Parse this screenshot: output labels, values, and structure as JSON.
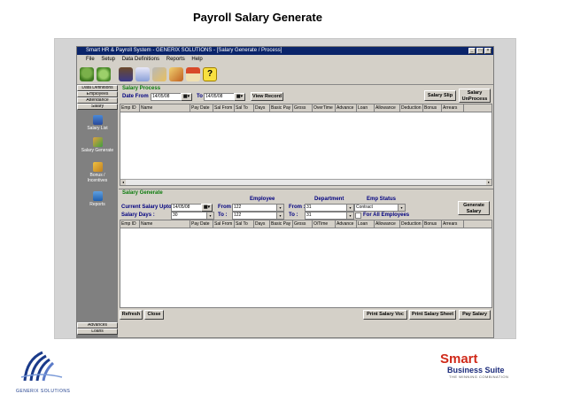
{
  "slide_title": "Payroll  Salary Generate",
  "window": {
    "title": "Smart HR & Payroll System - GENERIX SOLUTIONS - [Salary Generate / Process]",
    "menu": [
      "File",
      "Setup",
      "Data Definitions",
      "Reports",
      "Help"
    ]
  },
  "toolbar_icons": [
    "users-icon",
    "report-icon",
    "tools-icon",
    "edit-icon",
    "home-icon",
    "help-icon"
  ],
  "sidebar": {
    "tabs_top": [
      "Data Definitions",
      "Employees",
      "Attendance",
      "Salary"
    ],
    "items": [
      "Salary List",
      "Salary Generate",
      "Bonus / Incentives",
      "Reports"
    ],
    "tabs_bottom": [
      "Advances",
      "Loans"
    ]
  },
  "salary_process": {
    "heading": "Salary Process",
    "date_from_label": "Date From",
    "date_from": "14/05/08",
    "to_label": "To",
    "date_to": "14/05/08",
    "view_record": "View Record",
    "salary_slip": "Salary Slip",
    "salary_unprocess": "Salary UnProcess",
    "columns": [
      "Emp ID",
      "Name",
      "Pay Date",
      "Sal From",
      "Sal To",
      "Days",
      "Basic Pay",
      "Gross",
      "OverTime",
      "Advance",
      "Loan",
      "Allowance",
      "Deduction",
      "Bonus",
      "Arrears"
    ]
  },
  "salary_generate": {
    "heading": "Salary Generate",
    "employee_header": "Employee",
    "department_header": "Department",
    "emp_status_header": "Emp Status",
    "current_salary_upto_label": "Current Salary Upto :",
    "current_salary_upto": "14/05/08",
    "salary_days_label": "Salary Days :",
    "salary_days": "30",
    "from_label": "From :",
    "to_label": "To :",
    "emp_from": "122",
    "emp_to": "122",
    "dept_from": "31",
    "dept_to": "31",
    "emp_status": "Contract",
    "for_all_employees": "For All Employees",
    "generate_salary": "Generate Salary",
    "columns": [
      "Emp ID",
      "Name",
      "Pay Date",
      "Sal From",
      "Sal To",
      "Days",
      "Basic Pay",
      "Gross",
      "O/Time",
      "Advance",
      "Loan",
      "Allowance",
      "Deduction",
      "Bonus",
      "Arrears"
    ]
  },
  "buttons": {
    "refresh": "Refresh",
    "close": "Close",
    "print_salary_voc": "Print Salary Voc",
    "print_salary_sheet": "Print Salary Sheet",
    "pay_salary": "Pay Salary"
  },
  "logos": {
    "left_caption": "GENERIX SOLUTIONS",
    "right_title": "Smart",
    "right_subtitle": "Business Suite",
    "right_tagline": "THE WINNING COMBINATION"
  }
}
